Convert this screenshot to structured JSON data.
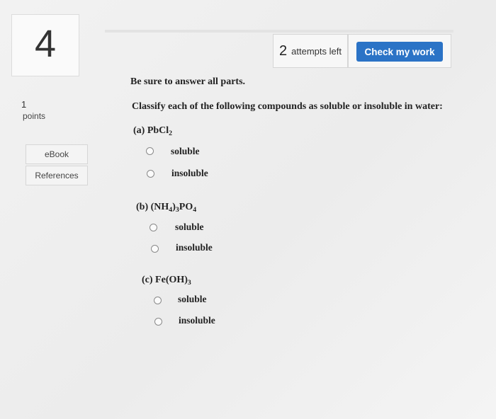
{
  "question_number": "4",
  "attempts": {
    "count": "2",
    "label": "attempts left"
  },
  "check_button": "Check my work",
  "points": {
    "value": "1",
    "label": "points"
  },
  "sidebar": {
    "ebook": "eBook",
    "references": "References"
  },
  "instructions": "Be sure to answer all parts.",
  "question": "Classify each of the following compounds as soluble or insoluble in water:",
  "parts": [
    {
      "label": "(a) ",
      "formula": [
        "PbCl",
        "2"
      ],
      "options": [
        "soluble",
        "insoluble"
      ]
    },
    {
      "label": "(b) ",
      "formula": [
        "(NH",
        "4",
        ")",
        "3",
        "PO",
        "4"
      ],
      "options": [
        "soluble",
        "insoluble"
      ]
    },
    {
      "label": "(c) ",
      "formula": [
        "Fe(OH)",
        "3"
      ],
      "options": [
        "soluble",
        "insoluble"
      ]
    }
  ]
}
